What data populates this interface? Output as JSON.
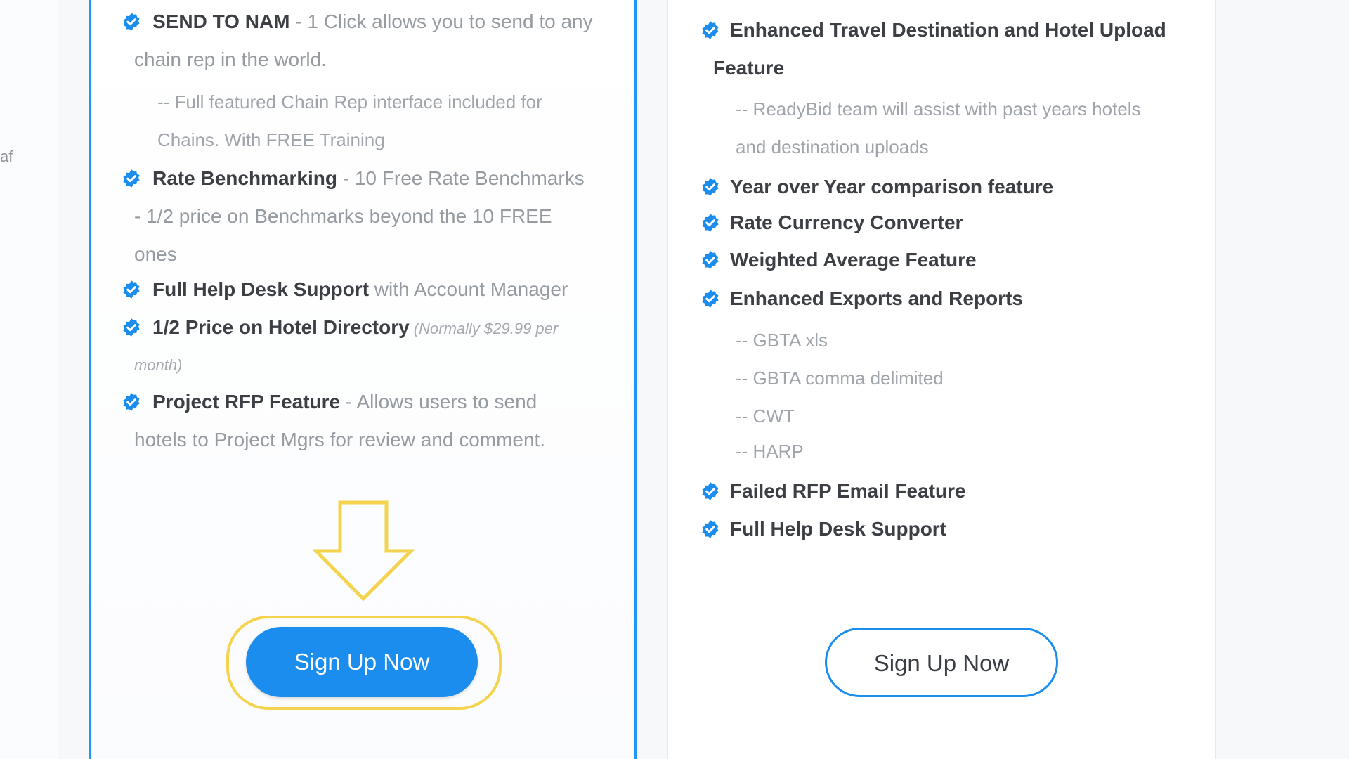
{
  "left_panel": {
    "cut_text": "af"
  },
  "left_card": {
    "features": [
      {
        "title": "SEND TO NAM",
        "desc": " - 1 Click allows you to send to any",
        "cont": "chain rep in the world."
      },
      {
        "sub1": "-- Full featured Chain Rep interface included for",
        "sub2": "Chains. With FREE Training"
      },
      {
        "title": "Rate Benchmarking",
        "desc": " - 10 Free Rate Benchmarks",
        "cont": "- 1/2 price on Benchmarks beyond the 10 FREE",
        "cont2": "ones"
      },
      {
        "title": "Full Help Desk Support",
        "desc": " with Account Manager"
      },
      {
        "title": "1/2 Price on Hotel Directory",
        "italic": " (Normally $29.99 per",
        "cont": "month)"
      },
      {
        "title": "Project RFP Feature",
        "desc": " - Allows users to send",
        "cont": "hotels to Project Mgrs for review and comment."
      }
    ],
    "button_label": "Sign Up Now"
  },
  "right_card": {
    "features": [
      {
        "title": "Enhanced Travel Destination and Hotel Upload",
        "cont": "Feature"
      },
      {
        "sub1": "-- ReadyBid team will assist with past years hotels",
        "sub2": "and destination uploads"
      },
      {
        "title": "Year over Year comparison feature"
      },
      {
        "title": "Rate Currency Converter"
      },
      {
        "title": "Weighted Average Feature"
      },
      {
        "title": "Enhanced Exports and Reports"
      },
      {
        "subs": [
          "-- GBTA xls",
          "-- GBTA comma delimited",
          "-- CWT",
          "-- HARP"
        ]
      },
      {
        "title": "Failed RFP Email Feature"
      },
      {
        "title": "Full Help Desk Support"
      }
    ],
    "button_label": "Sign Up Now"
  },
  "colors": {
    "accent": "#1b8def",
    "highlight": "#f4d34e",
    "check": "#1b8def"
  }
}
